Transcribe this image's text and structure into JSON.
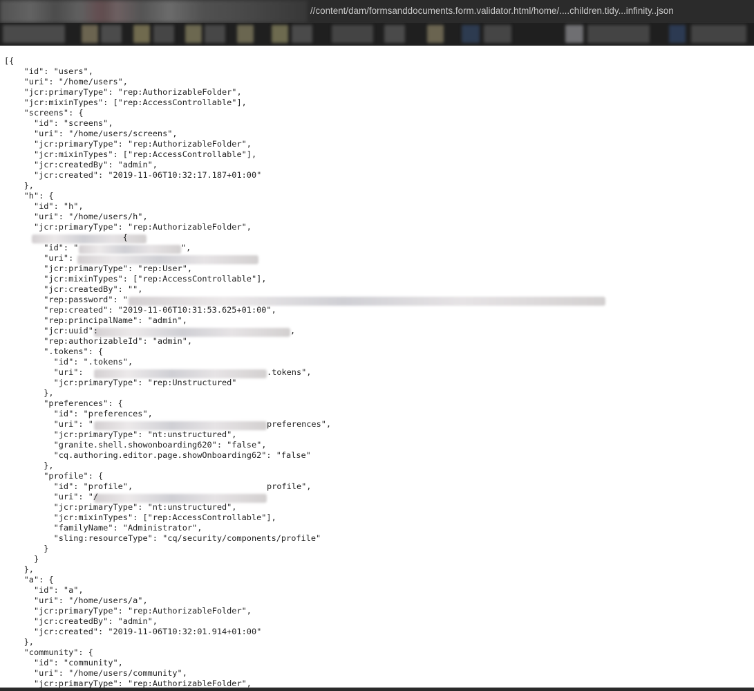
{
  "browser": {
    "url": "//content/dam/formsanddocuments.form.validator.html/home/....children.tidy...infinity..json"
  },
  "json_view": {
    "lines": [
      "[{",
      "    \"id\": \"users\",",
      "    \"uri\": \"/home/users\",",
      "    \"jcr:primaryType\": \"rep:AuthorizableFolder\",",
      "    \"jcr:mixinTypes\": [\"rep:AccessControllable\"],",
      "    \"screens\": {",
      "      \"id\": \"screens\",",
      "      \"uri\": \"/home/users/screens\",",
      "      \"jcr:primaryType\": \"rep:AuthorizableFolder\",",
      "      \"jcr:mixinTypes\": [\"rep:AccessControllable\"],",
      "      \"jcr:createdBy\": \"admin\",",
      "      \"jcr:created\": \"2019-11-06T10:32:17.187+01:00\"",
      "    },",
      "    \"h\": {",
      "      \"id\": \"h\",",
      "      \"uri\": \"/home/users/h\",",
      "      \"jcr:primaryType\": \"rep:AuthorizableFolder\",",
      "                        {",
      "        \"id\": \"",
      "        \"uri\":",
      "        \"jcr:primaryType\": \"rep:User\",",
      "        \"jcr:mixinTypes\": [\"rep:AccessControllable\"],",
      "        \"jcr:createdBy\": \"\",",
      "        \"rep:password\": \"",
      "        \"rep:created\": \"2019-11-06T10:31:53.625+01:00\",",
      "        \"rep:principalName\": \"admin\",",
      "        \"jcr:uuid\":",
      "        \"rep:authorizableId\": \"admin\",",
      "        \".tokens\": {",
      "          \"id\": \".tokens\",",
      "          \"uri\":",
      "          \"jcr:primaryType\": \"rep:Unstructured\"",
      "        },",
      "        \"preferences\": {",
      "          \"id\": \"preferences\",",
      "          \"uri\": \"",
      "          \"jcr:primaryType\": \"nt:unstructured\",",
      "          \"granite.shell.showonboarding620\": \"false\",",
      "          \"cq.authoring.editor.page.showOnboarding62\": \"false\"",
      "        },",
      "        \"profile\": {",
      "          \"id\": \"profile\",",
      "          \"uri\": \"/",
      "          \"jcr:primaryType\": \"nt:unstructured\",",
      "          \"jcr:mixinTypes\": [\"rep:AccessControllable\"],",
      "          \"familyName\": \"Administrator\",",
      "          \"sling:resourceType\": \"cq/security/components/profile\"",
      "        }",
      "      }",
      "    },",
      "    \"a\": {",
      "      \"id\": \"a\",",
      "      \"uri\": \"/home/users/a\",",
      "      \"jcr:primaryType\": \"rep:AuthorizableFolder\",",
      "      \"jcr:createdBy\": \"admin\",",
      "      \"jcr:created\": \"2019-11-06T10:32:01.914+01:00\"",
      "    },",
      "    \"community\": {",
      "      \"id\": \"community\",",
      "      \"uri\": \"/home/users/community\",",
      "      \"jcr:primaryType\": \"rep:AuthorizableFolder\","
    ],
    "line_suffixes": {
      "18": "\",",
      "26": ",",
      "30": ".tokens\",",
      "35": "preferences\",",
      "41": "profile\","
    }
  }
}
